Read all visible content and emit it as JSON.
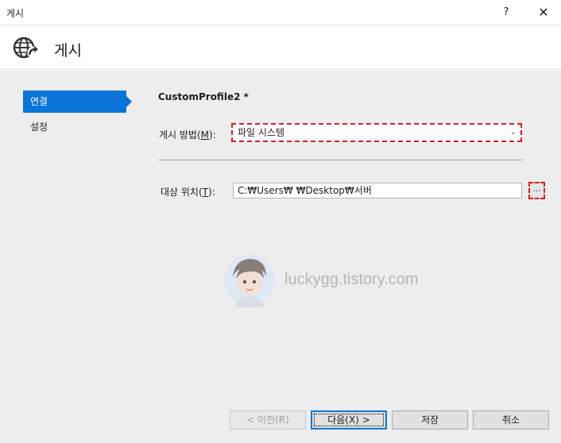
{
  "window": {
    "title": "게시",
    "help": "?",
    "close": "✕"
  },
  "header": {
    "title": "게시",
    "icon": "globe-publish-icon"
  },
  "sidebar": {
    "items": [
      {
        "label": "연결"
      },
      {
        "label": "설정"
      }
    ]
  },
  "profile": {
    "name": "CustomProfile2 *"
  },
  "publish_method": {
    "label_pre": "게시 방법(",
    "accel": "M",
    "label_post": "):",
    "value": "파일 시스템",
    "chevron": "⌄"
  },
  "target": {
    "label_pre": "대상 위치(",
    "accel": "T",
    "label_post": "):",
    "value": "C:₩Users₩       ₩Desktop₩서버",
    "browse": "..."
  },
  "watermark": {
    "text": "luckygg.tistory.com"
  },
  "buttons": {
    "prev": "< 이전(R)",
    "next": "다음(X) >",
    "save": "저장",
    "cancel": "취소"
  }
}
